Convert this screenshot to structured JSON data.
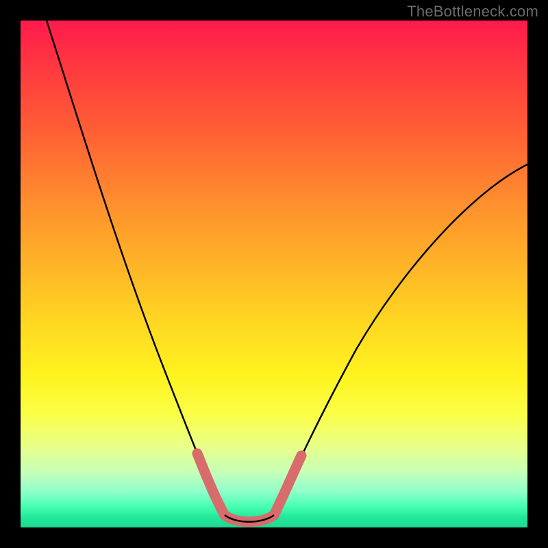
{
  "watermark": "TheBottleneck.com",
  "chart_data": {
    "type": "line",
    "title": "",
    "xlabel": "",
    "ylabel": "",
    "xlim": [
      0,
      100
    ],
    "ylim": [
      0,
      100
    ],
    "series": [
      {
        "name": "left-curve",
        "x": [
          5,
          10,
          15,
          20,
          25,
          30,
          35,
          37,
          39,
          41
        ],
        "y": [
          100,
          80,
          62,
          47,
          34,
          23,
          12,
          6,
          3,
          1
        ]
      },
      {
        "name": "valley-floor",
        "x": [
          41,
          44,
          47,
          50
        ],
        "y": [
          1,
          0,
          0,
          1
        ]
      },
      {
        "name": "right-curve",
        "x": [
          50,
          52,
          55,
          60,
          65,
          70,
          75,
          80,
          85,
          90,
          95,
          100
        ],
        "y": [
          1,
          3,
          7,
          15,
          24,
          33,
          42,
          50,
          57,
          63,
          68,
          72
        ]
      }
    ],
    "highlight_segments": [
      {
        "name": "left-marker",
        "x_range": [
          35,
          41
        ]
      },
      {
        "name": "floor-marker",
        "x_range": [
          41,
          50
        ]
      },
      {
        "name": "right-marker",
        "x_range": [
          50,
          55
        ]
      }
    ],
    "gradient_stops": [
      {
        "pct": 0,
        "color": "#ff1a4d"
      },
      {
        "pct": 70,
        "color": "#fff31e"
      },
      {
        "pct": 100,
        "color": "#1fd890"
      }
    ]
  }
}
